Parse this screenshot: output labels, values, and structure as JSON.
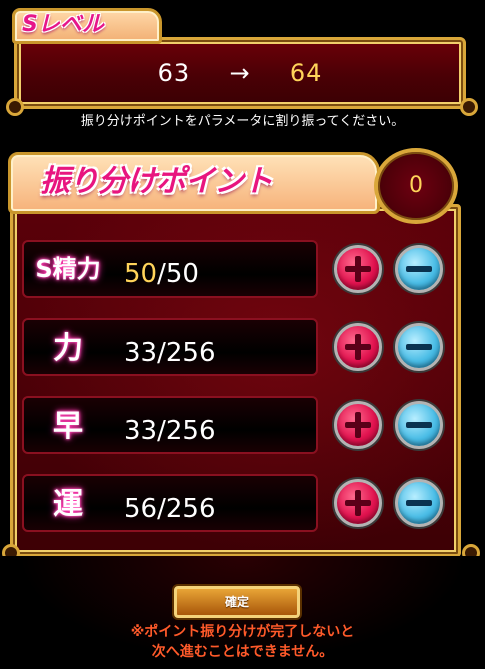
{
  "level": {
    "tab_label": "Sレベル",
    "from": "63",
    "arrow": "→",
    "to": "64"
  },
  "instruction": "振り分けポイントをパラメータに割り振ってください。",
  "allocation": {
    "title": "振り分けポイント",
    "points": "0",
    "stats": [
      {
        "label": "S精力",
        "current": "50",
        "max": "/50",
        "highlight": true
      },
      {
        "label": "力",
        "current": "33",
        "max": "/256",
        "highlight": false
      },
      {
        "label": "早",
        "current": "33",
        "max": "/256",
        "highlight": false
      },
      {
        "label": "運",
        "current": "56",
        "max": "/256",
        "highlight": false
      }
    ]
  },
  "confirm_label": "確定",
  "notice_lines": [
    "※ポイント振り分けが完了しないと",
    "次へ進むことはできません。"
  ],
  "colors": {
    "panel": "#4a0005",
    "gold_border": "#d9a73a",
    "pink_title": "#e8157f",
    "highlight_value": "#ffd45a",
    "plus_button": "#e1134f",
    "minus_button": "#4bbde6",
    "notice": "#ff5a2a"
  },
  "icons": {
    "plus": "plus-icon",
    "minus": "minus-icon"
  }
}
